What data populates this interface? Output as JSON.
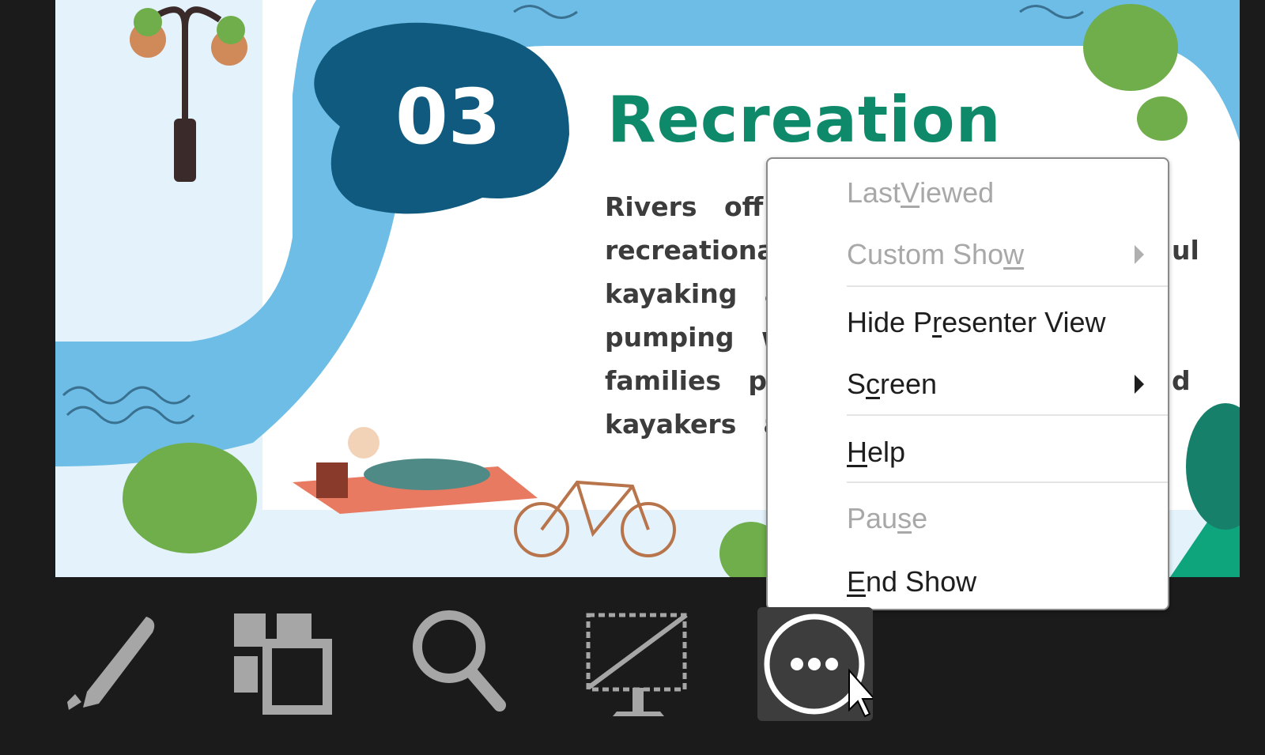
{
  "slide": {
    "number": "03",
    "title": "Recreation",
    "body_lines": [
      "Rivers   off",
      "recreationa",
      "kayaking   a",
      "pumping   wh",
      "families   pic",
      "kayakers   a"
    ],
    "body_right": [
      "ul",
      "d"
    ],
    "colors": {
      "river": "#6dbde6",
      "badge": "#0f5a7e",
      "title": "#0e8a6a",
      "bush": "#6fae4a"
    }
  },
  "context_menu": {
    "items": [
      {
        "pre": "Last ",
        "key": "V",
        "post": "iewed",
        "disabled": true
      },
      {
        "pre": "Custom Sho",
        "key": "w",
        "post": "",
        "disabled": true,
        "submenu": true
      },
      {
        "pre": "Hide P",
        "key": "r",
        "post": "esenter View",
        "disabled": false
      },
      {
        "pre": "S",
        "key": "c",
        "post": "reen",
        "disabled": false,
        "submenu": true
      },
      {
        "pre": "",
        "key": "H",
        "post": "elp",
        "disabled": false
      },
      {
        "pre": "Pau",
        "key": "s",
        "post": "e",
        "disabled": true
      },
      {
        "pre": "",
        "key": "E",
        "post": "nd Show",
        "disabled": false
      }
    ]
  },
  "toolbar": {
    "icons": [
      "pen-icon",
      "see-all-slides-icon",
      "zoom-icon",
      "black-screen-icon",
      "more-options-icon"
    ]
  }
}
